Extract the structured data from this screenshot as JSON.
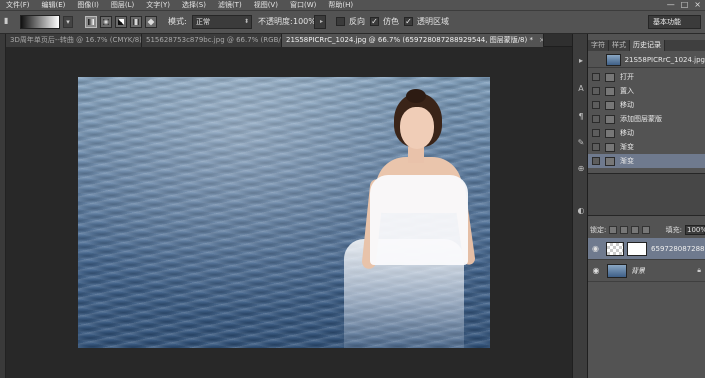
{
  "menubar": {
    "items": [
      "文件(F)",
      "编辑(E)",
      "图像(I)",
      "图层(L)",
      "文字(Y)",
      "选择(S)",
      "滤镜(T)",
      "视图(V)",
      "窗口(W)",
      "帮助(H)"
    ],
    "window_buttons": [
      "—",
      "□",
      "×"
    ]
  },
  "options": {
    "mode_label": "模式:",
    "mode_value": "正常",
    "opacity_label": "不透明度:",
    "opacity_value": "100%",
    "reverse_label": "反向",
    "dither_label": "仿色",
    "transparency_label": "透明区域",
    "reverse_checked": false,
    "dither_checked": true,
    "transparency_checked": true,
    "workspace": "基本功能"
  },
  "tabs": [
    {
      "label": "3D周年单页后--转曲 @ 16.7% (CMYK/8)"
    },
    {
      "label": "515628753c879bc.jpg @ 66.7% (RGB/8#)"
    },
    {
      "label": "21S58PICRrC_1024.jpg @ 66.7% (6597280872889295​44, 图层蒙版/8) *"
    }
  ],
  "panel": {
    "tabs": [
      "字符",
      "样式",
      "历史记录"
    ],
    "active_tab": "历史记录",
    "snapshot_name": "21S58PICRrC_1024.jpg",
    "history": [
      "打开",
      "置入",
      "移动",
      "添加图层蒙版",
      "移动",
      "渐变",
      "渐变"
    ],
    "active_history_index": 6
  },
  "layers": {
    "lock_label": "锁定:",
    "fill_label": "填充:",
    "fill_value": "100%",
    "rows": [
      {
        "name": "659728087288...",
        "active": true
      },
      {
        "name": "背景",
        "active": false
      }
    ]
  },
  "colors": {
    "ui_dark": "#535353",
    "canvas_bg": "#282828",
    "selection": "#6f7a8e"
  }
}
